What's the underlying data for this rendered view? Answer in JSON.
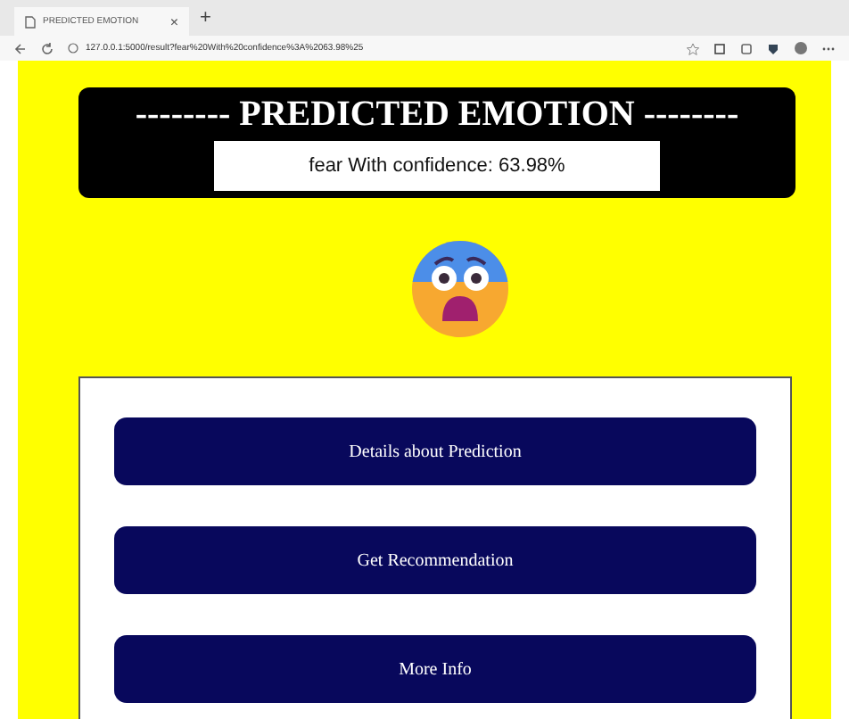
{
  "browser": {
    "tab_title": "PREDICTED EMOTION",
    "tab_close": "×",
    "new_tab": "+",
    "url": "127.0.0.1:5000/result?fear%20With%20confidence%3A%2063.98%25"
  },
  "header": {
    "title": "-------- PREDICTED EMOTION --------",
    "result": "fear With confidence: 63.98%"
  },
  "buttons": [
    {
      "label": "Details about Prediction"
    },
    {
      "label": "Get Recommendation"
    },
    {
      "label": "More Info"
    }
  ]
}
